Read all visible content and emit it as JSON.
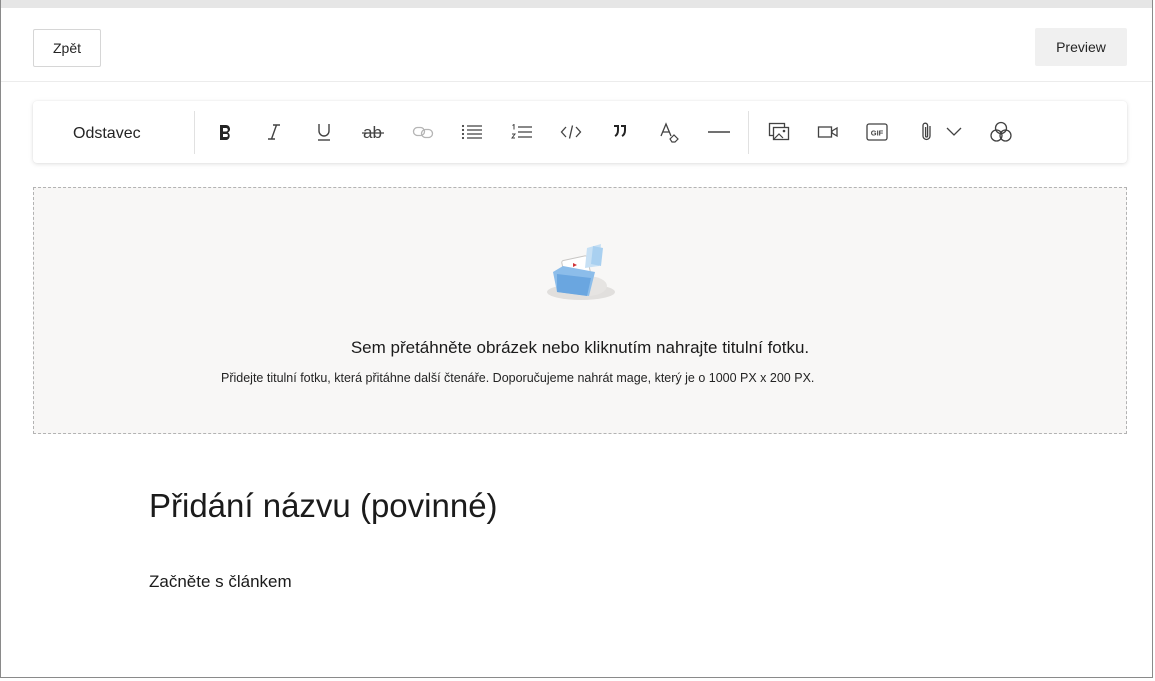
{
  "header": {
    "back_label": "Zpět",
    "preview_label": "Preview"
  },
  "toolbar": {
    "paragraph_style": "Odstavec",
    "tools": [
      {
        "name": "bold-icon",
        "enabled": true
      },
      {
        "name": "italic-icon",
        "enabled": true
      },
      {
        "name": "underline-icon",
        "enabled": true
      },
      {
        "name": "strikethrough-icon",
        "enabled": true
      },
      {
        "name": "link-icon",
        "enabled": false
      },
      {
        "name": "bullet-list-icon",
        "enabled": true
      },
      {
        "name": "numbered-list-icon",
        "enabled": true
      },
      {
        "name": "code-icon",
        "enabled": true
      },
      {
        "name": "quote-icon",
        "enabled": true
      },
      {
        "name": "clear-formatting-icon",
        "enabled": true
      },
      {
        "name": "horizontal-rule-icon",
        "enabled": true
      },
      {
        "name": "insert-image-icon",
        "enabled": true
      },
      {
        "name": "insert-video-icon",
        "enabled": true
      },
      {
        "name": "insert-gif-icon",
        "enabled": true
      },
      {
        "name": "attachment-icon",
        "enabled": true
      },
      {
        "name": "chevron-down-icon",
        "enabled": true
      },
      {
        "name": "copilot-icon",
        "enabled": true
      }
    ],
    "gif_label": "GIF"
  },
  "cover": {
    "title": "Sem přetáhněte obrázek nebo kliknutím nahrajte titulní fotku.",
    "subtitle": "Přidejte titulní fotku, která přitáhne další čtenáře. Doporučujeme nahrát mage, který je o 1000 PX x 200 PX."
  },
  "article": {
    "title_placeholder": "Přidání názvu (povinné)",
    "body_placeholder": "Začněte s článkem"
  },
  "colors": {
    "disabled_icon": "#b5b5b5",
    "icon": "#424242",
    "dropzone_bg": "#f8f7f6"
  }
}
